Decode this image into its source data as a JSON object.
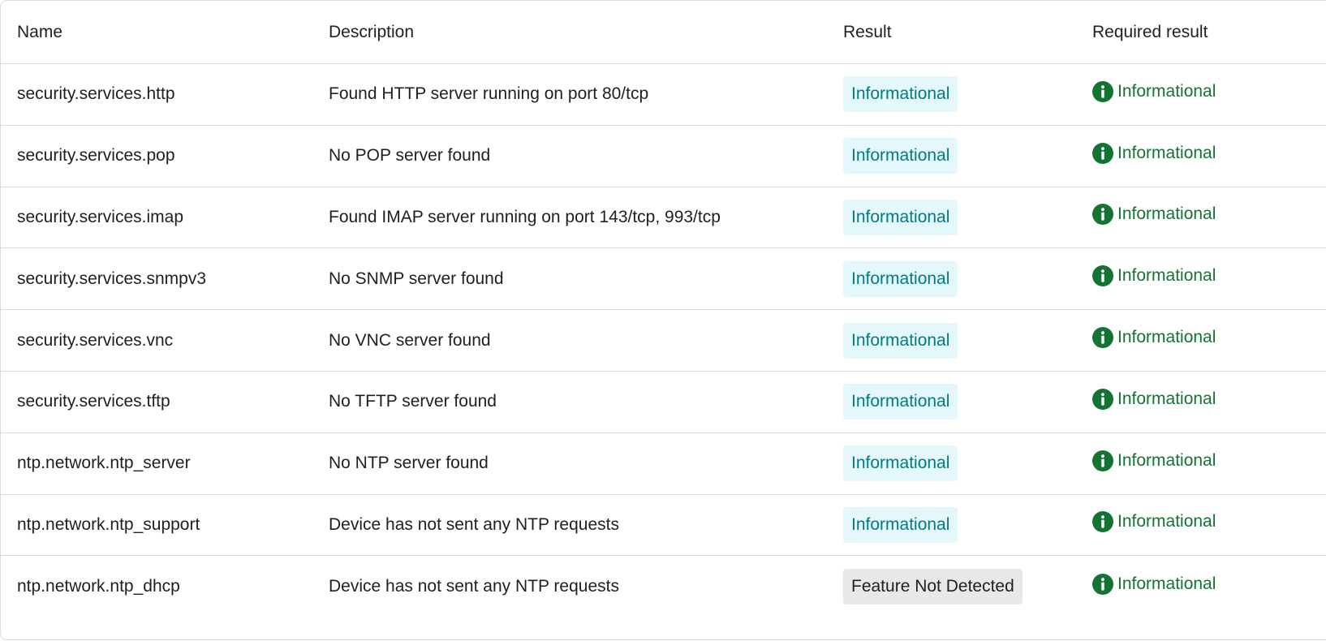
{
  "columns": {
    "name": "Name",
    "description": "Description",
    "result": "Result",
    "required_result": "Required result"
  },
  "colors": {
    "info_chip_bg": "#e4f7fb",
    "info_chip_text": "#007b83",
    "not_detected_chip_bg": "#e8e8e8",
    "required_green": "#137333"
  },
  "icons": {
    "required_result": "info-circle-icon"
  },
  "rows": [
    {
      "name": "security.services.http",
      "description": "Found HTTP server running on port 80/tcp",
      "result": "Informational",
      "result_type": "info",
      "required": "Informational"
    },
    {
      "name": "security.services.pop",
      "description": "No POP server found",
      "result": "Informational",
      "result_type": "info",
      "required": "Informational"
    },
    {
      "name": "security.services.imap",
      "description": "Found IMAP server running on port 143/tcp, 993/tcp",
      "result": "Informational",
      "result_type": "info",
      "required": "Informational"
    },
    {
      "name": "security.services.snmpv3",
      "description": "No SNMP server found",
      "result": "Informational",
      "result_type": "info",
      "required": "Informational"
    },
    {
      "name": "security.services.vnc",
      "description": "No VNC server found",
      "result": "Informational",
      "result_type": "info",
      "required": "Informational"
    },
    {
      "name": "security.services.tftp",
      "description": "No TFTP server found",
      "result": "Informational",
      "result_type": "info",
      "required": "Informational"
    },
    {
      "name": "ntp.network.ntp_server",
      "description": "No NTP server found",
      "result": "Informational",
      "result_type": "info",
      "required": "Informational"
    },
    {
      "name": "ntp.network.ntp_support",
      "description": "Device has not sent any NTP requests",
      "result": "Informational",
      "result_type": "info",
      "required": "Informational"
    },
    {
      "name": "ntp.network.ntp_dhcp",
      "description": "Device has not sent any NTP requests",
      "result": "Feature Not Detected",
      "result_type": "notdetected",
      "required": "Informational"
    }
  ]
}
